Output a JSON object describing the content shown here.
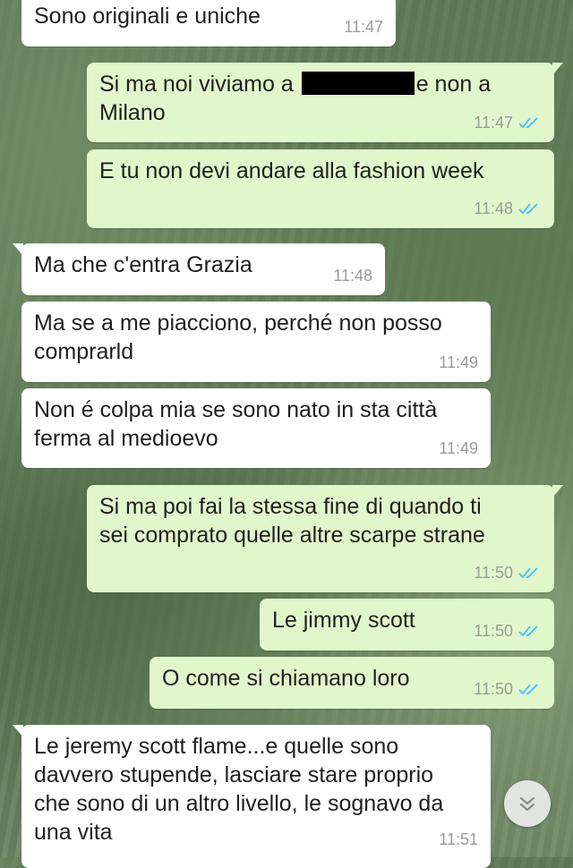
{
  "conversation": {
    "messages": [
      {
        "dir": "in",
        "text": "Sono originali e uniche",
        "time": "11:47"
      },
      {
        "dir": "out",
        "text_before": "Si ma noi viviamo a",
        "text_after": "e non a\nMilano",
        "time": "11:47",
        "read": true
      },
      {
        "dir": "out",
        "text": "E tu non devi andare alla fashion week",
        "time": "11:48",
        "read": true
      },
      {
        "dir": "in",
        "text": "Ma che c'entra Grazia",
        "time": "11:48"
      },
      {
        "dir": "in",
        "text": "Ma se a me piacciono, perché non posso\ncomprarld",
        "time": "11:49"
      },
      {
        "dir": "in",
        "text": "Non é colpa mia se sono nato in sta città\nferma al medioevo",
        "time": "11:49"
      },
      {
        "dir": "out",
        "text": "Si ma poi fai la stessa fine di quando ti\nsei comprato quelle altre scarpe strane",
        "time": "11:50",
        "read": true
      },
      {
        "dir": "out",
        "text": "Le jimmy scott",
        "time": "11:50",
        "read": true
      },
      {
        "dir": "out",
        "text": "O come si chiamano loro",
        "time": "11:50",
        "read": true
      },
      {
        "dir": "in",
        "text": "Le jeremy scott flame...e quelle sono\ndavvero stupende, lasciare stare proprio\nche sono di un altro livello, le sognavo da\nuna vita",
        "time": "11:51"
      }
    ],
    "scroll_button_icon": "chevron-double-down-icon",
    "read_tick_color": "#4fc3f7"
  }
}
